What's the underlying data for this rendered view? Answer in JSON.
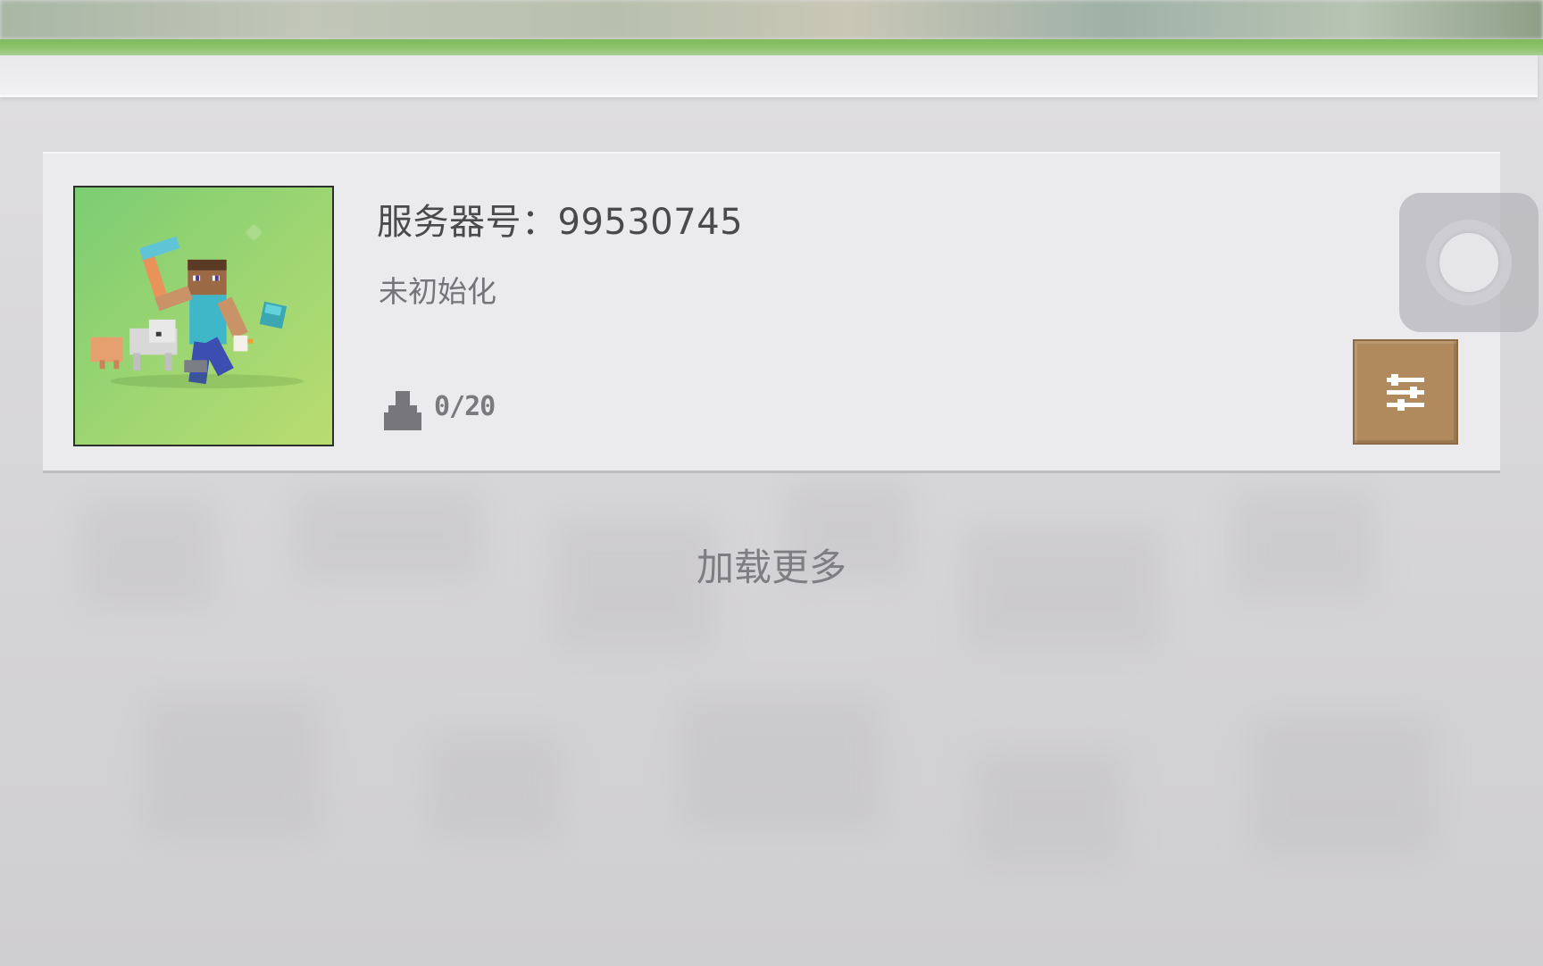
{
  "server": {
    "title": "服务器号：99530745",
    "status": "未初始化",
    "players": "0/20"
  },
  "list": {
    "load_more": "加载更多"
  },
  "icons": {
    "thumbnail": "minecraft-steve-thumbnail-icon",
    "players": "player-icon",
    "settings": "sliders-icon",
    "assistive": "assistive-touch-icon"
  },
  "colors": {
    "accent_green": "#8fc56e",
    "settings_button": "#b08a5d",
    "card_background": "#ebeaec"
  }
}
